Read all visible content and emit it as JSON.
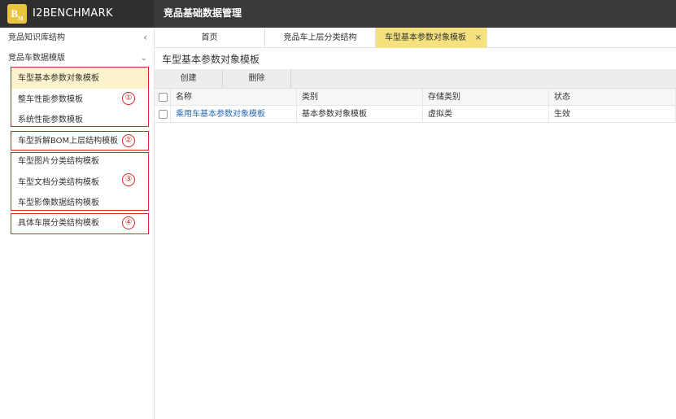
{
  "header": {
    "logo_letters": "B",
    "logo_sub": "M",
    "brand": "I2BENCHMARK",
    "app_title": "竞品基础数据管理"
  },
  "sidebar": {
    "section1": "竞品知识库结构",
    "section2": "竞品车数据模版",
    "items": [
      {
        "label": "车型基本参数对象模板",
        "active": true
      },
      {
        "label": "整车性能参数模板"
      },
      {
        "label": "系统性能参数模板"
      },
      {
        "label": "车型拆解BOM上层结构模板"
      },
      {
        "label": "车型图片分类结构模板"
      },
      {
        "label": "车型文档分类结构模板"
      },
      {
        "label": "车型影像数据结构模板"
      },
      {
        "label": "具体车展分类结构模板"
      }
    ],
    "annotations": [
      "①",
      "②",
      "③",
      "④"
    ],
    "annotation_color": "#e02424"
  },
  "tabs": [
    {
      "label": "首页"
    },
    {
      "label": "竞品车上层分类结构"
    },
    {
      "label": "车型基本参数对象模板",
      "active": true
    }
  ],
  "tab_close": "×",
  "main": {
    "title": "车型基本参数对象模板",
    "toolbar": {
      "create": "创建",
      "delete": "删除"
    },
    "table": {
      "columns": [
        "名称",
        "类别",
        "存储类别",
        "状态"
      ],
      "rows": [
        [
          "乘用车基本参数对象模板",
          "基本参数对象模板",
          "虚拟类",
          "生效"
        ]
      ]
    }
  },
  "colors": {
    "header_bg": "#3a3a3a",
    "logo": "#e9c441",
    "active_tab": "#f5e27e",
    "active_item": "#fcf3cc",
    "link": "#2a6bb5"
  }
}
